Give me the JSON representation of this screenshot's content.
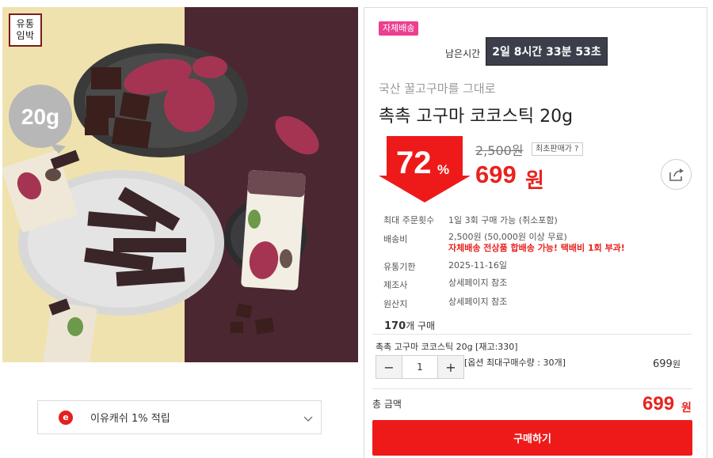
{
  "image_badge": {
    "line1": "유통",
    "line2": "임박"
  },
  "image_weight_label": "20g",
  "eyou": {
    "icon_letter": "e",
    "text": "이유캐쉬 1% 적립"
  },
  "tag_self_shipping": "자체배송",
  "timer": {
    "label": "남은시간",
    "value": "2일 8시간 33분 53초"
  },
  "product": {
    "subtitle": "국산 꿀고구마를 그대로",
    "title": "촉촉 고구마 코코스틱 20g"
  },
  "price": {
    "discount": "72",
    "discount_unit": "%",
    "original": "2,500원",
    "lowest_tag": "최초판매가 ?",
    "sale": "699",
    "sale_unit": "원"
  },
  "info": [
    {
      "label": "최대 주문횟수",
      "value": "1일 3회 구매 가능 (취소포함)"
    },
    {
      "label": "배송비",
      "value": "2,500원 (50,000원 이상 무료)",
      "warn": "자체배송 전상품 합배송 가능! 택배비 1회 부과!"
    },
    {
      "label": "유통기한",
      "value": "2025-11-16일"
    },
    {
      "label": "제조사",
      "value": "상세페이지 참조"
    },
    {
      "label": "원산지",
      "value": "상세페이지 참조"
    }
  ],
  "purchase": {
    "count": "170",
    "suffix": "개 구매"
  },
  "option": {
    "name": "촉촉 고구마 코코스틱 20g [재고:330]",
    "minus": "−",
    "qty": "1",
    "plus": "+",
    "max_note": "[옵션 최대구매수량 : 30개]",
    "price": "699",
    "price_unit": "원"
  },
  "total": {
    "label": "총 금액",
    "price": "699",
    "unit": "원"
  },
  "buy_button": "구매하기",
  "colors": {
    "accent_red": "#ee1a1a",
    "timer_bg": "#3c3f4b",
    "tag_pink": "#ec3f8f"
  }
}
